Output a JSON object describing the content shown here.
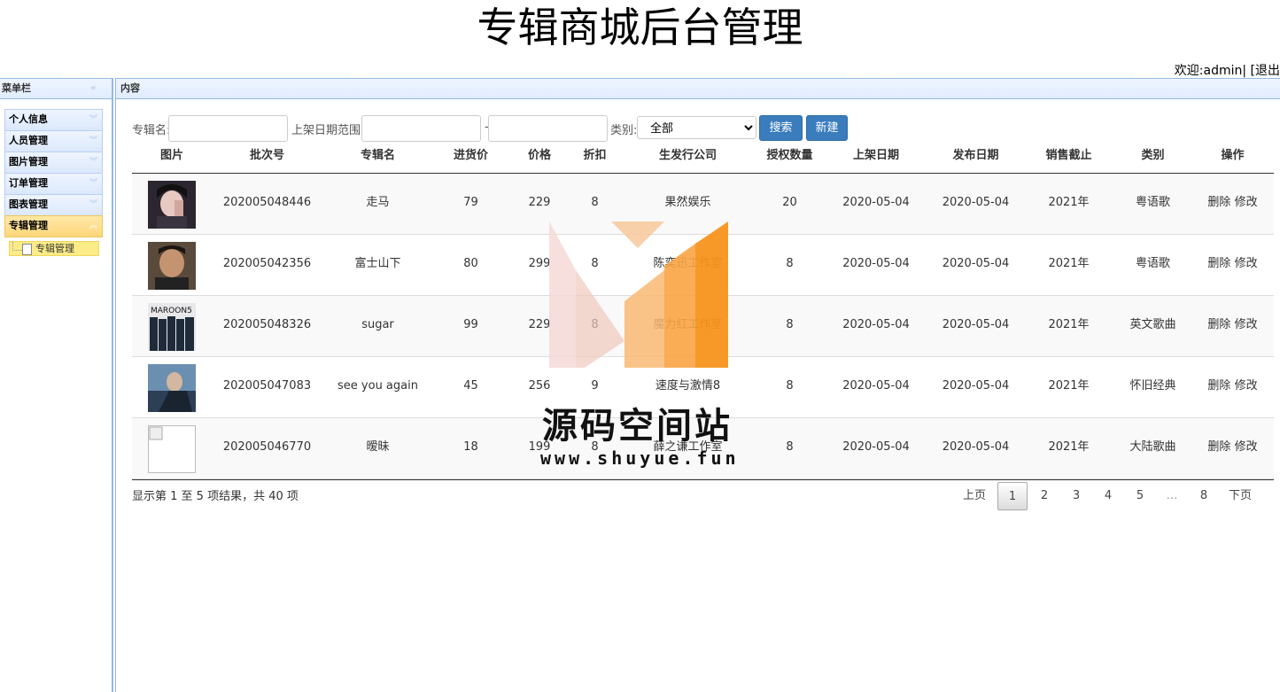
{
  "header": {
    "title": "专辑商城后台管理",
    "welcome_prefix": "欢迎:",
    "username": "admin",
    "separator": "|",
    "logout": "[退出"
  },
  "sidebar": {
    "title": "菜单栏",
    "items": [
      {
        "label": "个人信息"
      },
      {
        "label": "人员管理"
      },
      {
        "label": "图片管理"
      },
      {
        "label": "订单管理"
      },
      {
        "label": "图表管理"
      },
      {
        "label": "专辑管理"
      }
    ],
    "active_sub": "专辑管理"
  },
  "content": {
    "title": "内容"
  },
  "search": {
    "album_label": "专辑名:",
    "album_value": "",
    "date_label": "上架日期范围:",
    "date_from": "",
    "date_sep": "-",
    "date_to": "",
    "category_label": "类别:",
    "category_value": "全部",
    "search_button": "搜索",
    "new_button": "新建"
  },
  "table": {
    "headers": [
      "图片",
      "批次号",
      "专辑名",
      "进货价",
      "价格",
      "折扣",
      "生发行公司",
      "授权数量",
      "上架日期",
      "发布日期",
      "销售截止",
      "类别",
      "操作"
    ],
    "rows": [
      {
        "image": "portrait-woman",
        "batch": "202005048446",
        "name": "走马",
        "cost": "79",
        "price": "229",
        "discount": "8",
        "company": "果然娱乐",
        "license": "20",
        "shelf_date": "2020-05-04",
        "release_date": "2020-05-04",
        "sale_end": "2021年",
        "category": "粤语歌",
        "delete": "删除",
        "edit": "修改"
      },
      {
        "image": "portrait-man",
        "batch": "202005042356",
        "name": "富士山下",
        "cost": "80",
        "price": "299",
        "discount": "8",
        "company": "陈奕迅工作室",
        "license": "8",
        "shelf_date": "2020-05-04",
        "release_date": "2020-05-04",
        "sale_end": "2021年",
        "category": "粤语歌",
        "delete": "删除",
        "edit": "修改"
      },
      {
        "image": "band-photo",
        "batch": "202005048326",
        "name": "sugar",
        "cost": "99",
        "price": "229",
        "discount": "8",
        "company": "魔力红工作室",
        "license": "8",
        "shelf_date": "2020-05-04",
        "release_date": "2020-05-04",
        "sale_end": "2021年",
        "category": "英文歌曲",
        "delete": "删除",
        "edit": "修改"
      },
      {
        "image": "blue-portrait",
        "batch": "202005047083",
        "name": "see you again",
        "cost": "45",
        "price": "256",
        "discount": "9",
        "company": "速度与激情8",
        "license": "8",
        "shelf_date": "2020-05-04",
        "release_date": "2020-05-04",
        "sale_end": "2021年",
        "category": "怀旧经典",
        "delete": "删除",
        "edit": "修改"
      },
      {
        "image": "broken-image",
        "batch": "202005046770",
        "name": "暧昧",
        "cost": "18",
        "price": "199",
        "discount": "8",
        "company": "薛之谦工作室",
        "license": "8",
        "shelf_date": "2020-05-04",
        "release_date": "2020-05-04",
        "sale_end": "2021年",
        "category": "大陆歌曲",
        "delete": "删除",
        "edit": "修改"
      }
    ]
  },
  "pagination": {
    "info": "显示第 1 至 5 项结果，共 40 项",
    "prev": "上页",
    "pages": [
      "1",
      "2",
      "3",
      "4",
      "5",
      "…",
      "8"
    ],
    "current": "1",
    "next": "下页"
  },
  "watermark": {
    "text": "源码空间站",
    "url": "www.shuyue.fun"
  },
  "colors": {
    "accent": "#3a7cbc",
    "panel_border": "#95b8e7",
    "active_menu": "#fdd67c",
    "watermark_orange": "#f7931e"
  }
}
